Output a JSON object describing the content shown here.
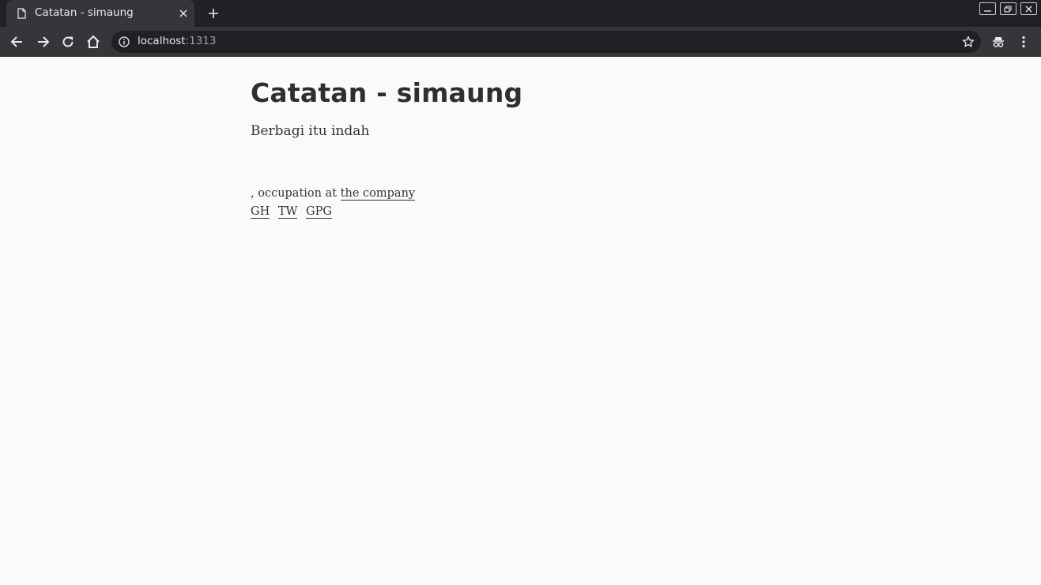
{
  "browser": {
    "tab_title": "Catatan - simaung",
    "url_host": "localhost",
    "url_port": ":1313"
  },
  "page": {
    "title": "Catatan - simaung",
    "description": "Berbagi itu indah",
    "bio_prefix": ", occupation at ",
    "bio_link": "the company",
    "social_links": [
      "GH",
      "TW",
      "GPG"
    ]
  }
}
